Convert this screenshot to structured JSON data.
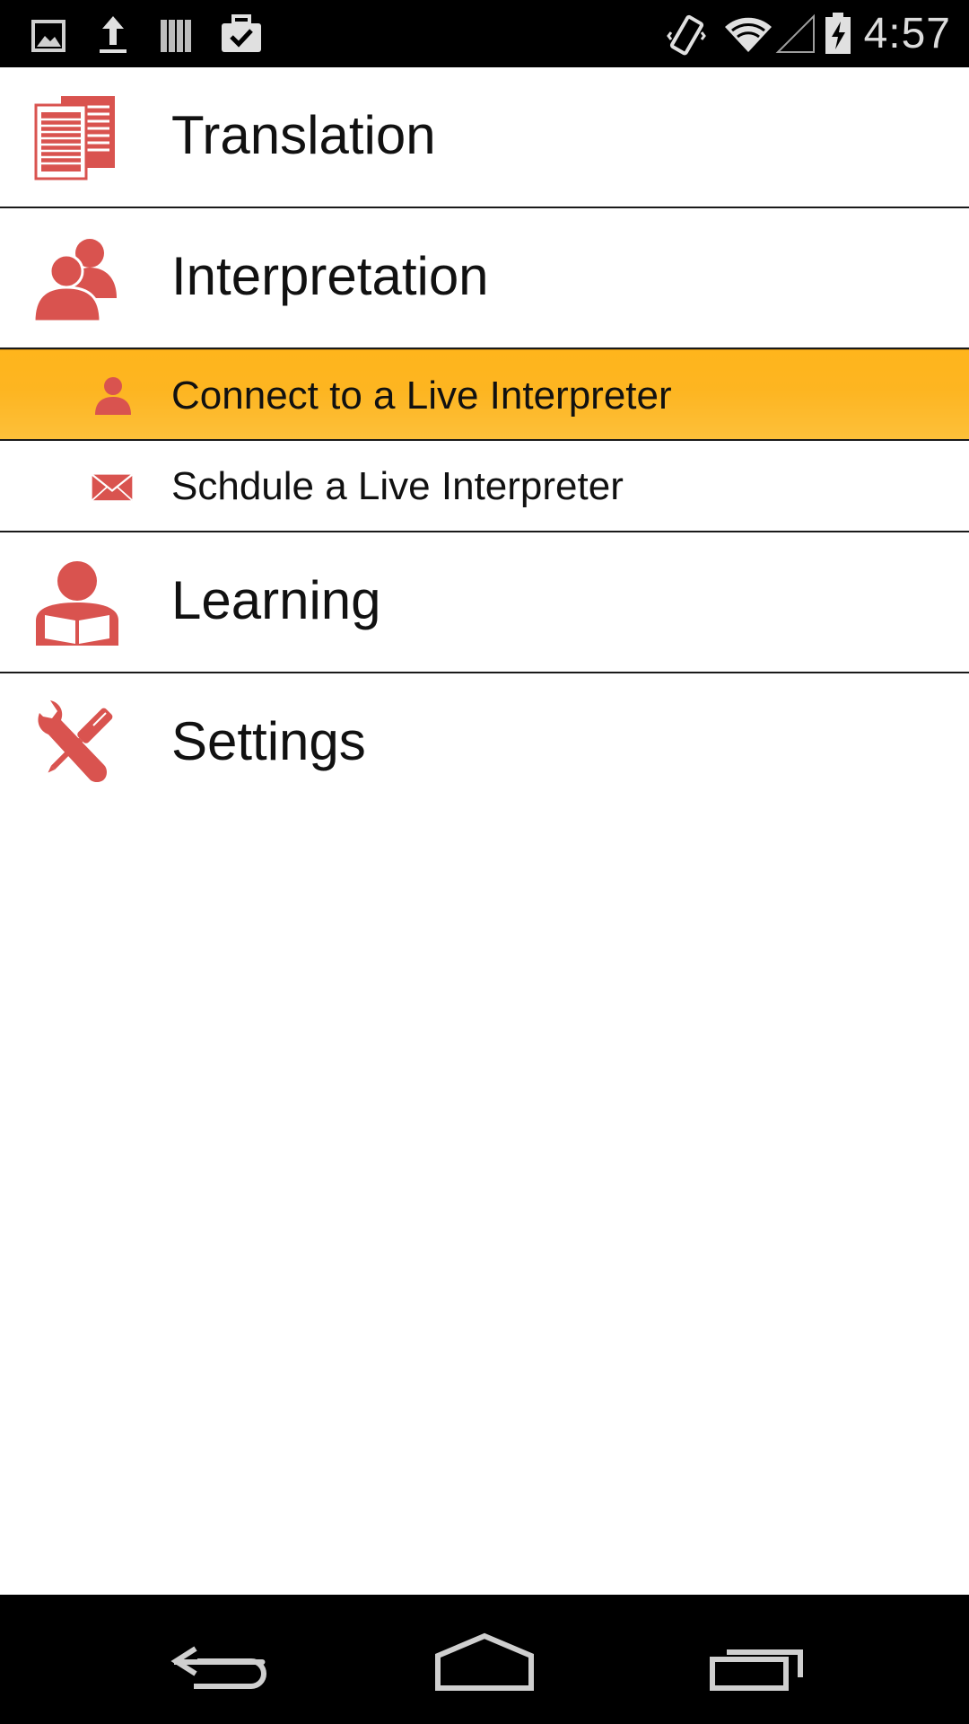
{
  "status_bar": {
    "left_icons": [
      "gallery-icon",
      "upload-icon",
      "library-icon",
      "briefcase-check-icon"
    ],
    "right_icons": [
      "vibrate-icon",
      "wifi-icon",
      "signal-icon",
      "battery-charging-icon"
    ],
    "time": "4:57"
  },
  "menu": {
    "items": [
      {
        "label": "Translation",
        "icon": "document-icon",
        "level": "main"
      },
      {
        "label": "Interpretation",
        "icon": "people-icon",
        "level": "main"
      },
      {
        "label": "Connect to a Live Interpreter",
        "icon": "person-icon",
        "level": "sub",
        "selected": true
      },
      {
        "label": "Schdule a Live Interpreter",
        "icon": "envelope-icon",
        "level": "sub"
      },
      {
        "label": "Learning",
        "icon": "reader-icon",
        "level": "main"
      },
      {
        "label": "Settings",
        "icon": "tools-icon",
        "level": "main"
      }
    ]
  },
  "nav_bar": {
    "buttons": [
      "back-icon",
      "home-icon",
      "recents-icon"
    ]
  },
  "colors": {
    "icon_red": "#d9534f",
    "selected_orange": "#fdb521",
    "bar_black": "#000000"
  }
}
